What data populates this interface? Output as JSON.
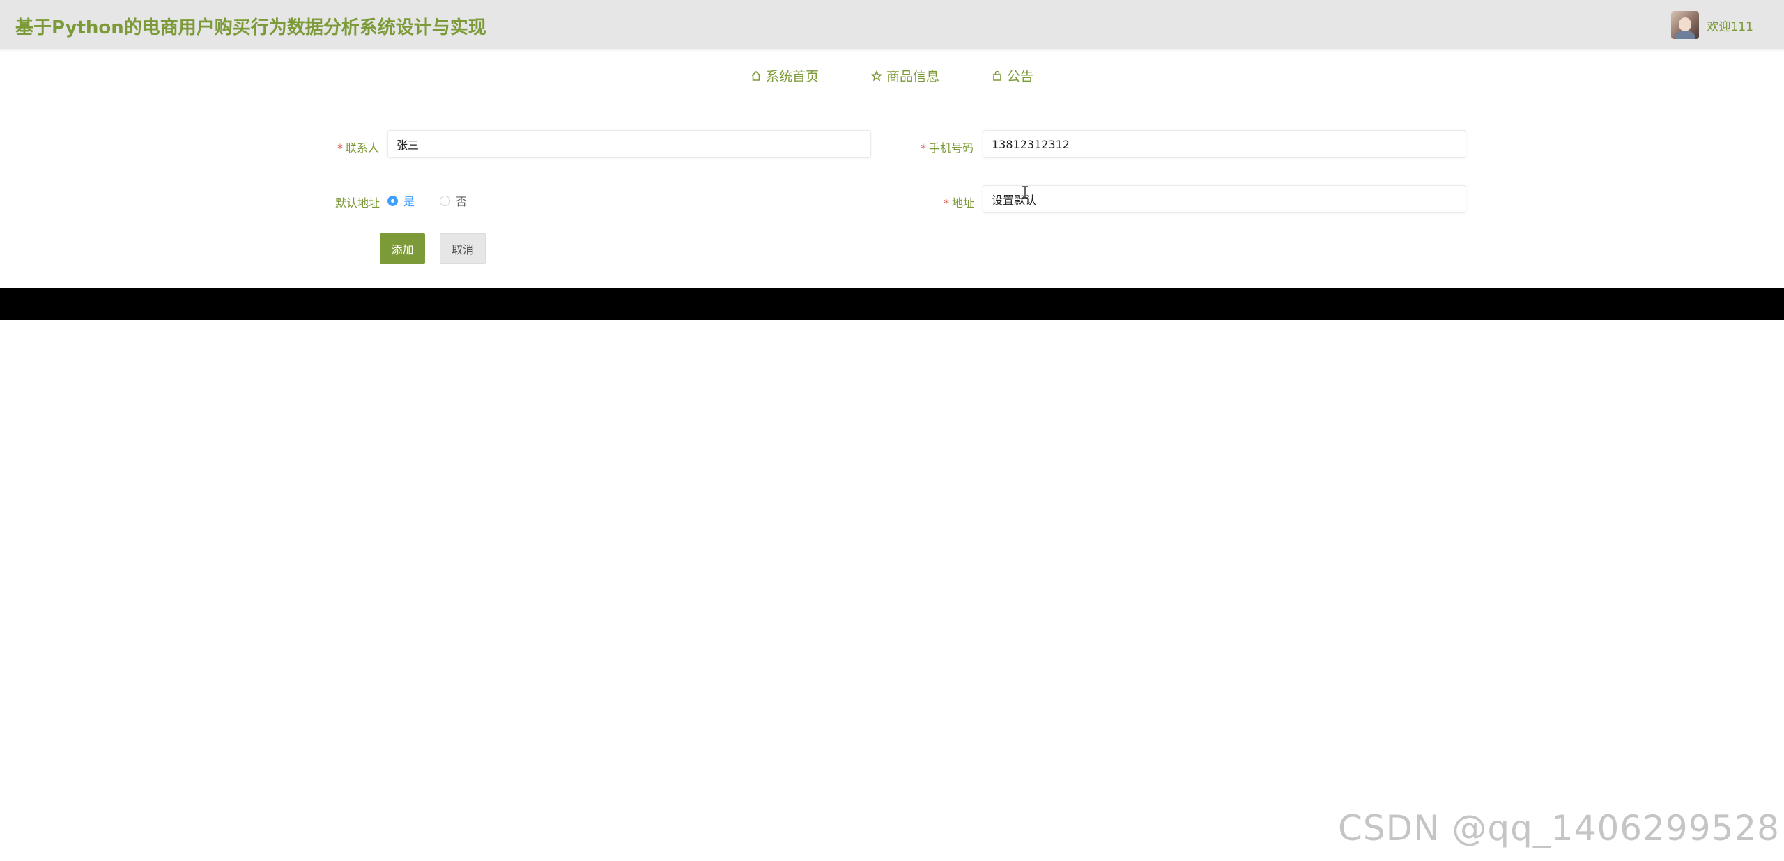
{
  "header": {
    "title": "基于Python的电商用户购买行为数据分析系统设计与实现",
    "welcome": "欢迎111"
  },
  "nav": {
    "items": [
      {
        "label": "系统首页",
        "icon": "home-icon"
      },
      {
        "label": "商品信息",
        "icon": "star-icon"
      },
      {
        "label": "公告",
        "icon": "bag-icon"
      }
    ]
  },
  "form": {
    "contact": {
      "label": "联系人",
      "value": "张三",
      "required": "*"
    },
    "phone": {
      "label": "手机号码",
      "value": "13812312312",
      "required": "*"
    },
    "default_address": {
      "label": "默认地址",
      "options": [
        {
          "label": "是",
          "checked": true
        },
        {
          "label": "否",
          "checked": false
        }
      ]
    },
    "address": {
      "label": "地址",
      "value": "设置默认",
      "required": "*"
    },
    "add_button": "添加",
    "cancel_button": "取消"
  },
  "watermark": "CSDN @qq_1406299528",
  "colors": {
    "accent": "#7c9a38",
    "header_bg": "#e6e6e6",
    "radio_checked": "#409eff",
    "required": "#e05656"
  }
}
